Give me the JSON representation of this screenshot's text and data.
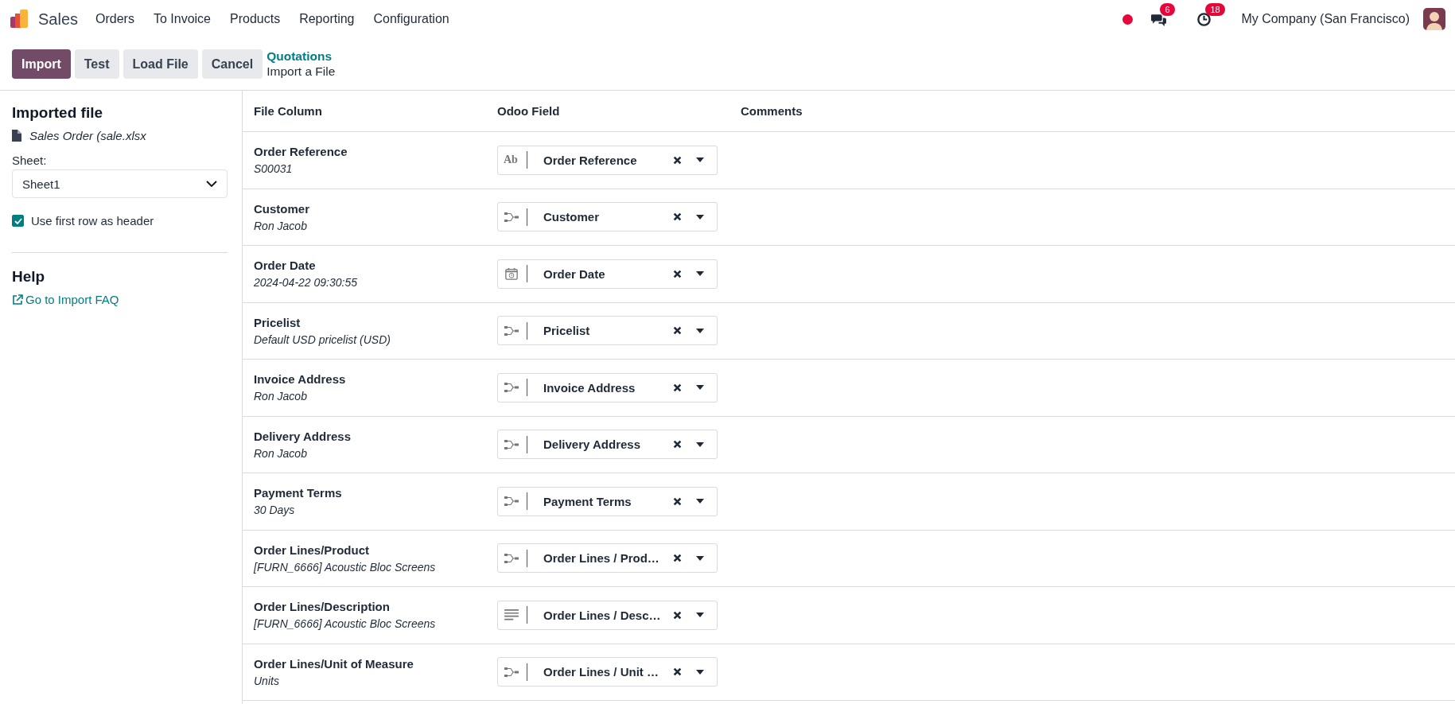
{
  "navbar": {
    "app_name": "Sales",
    "menu": [
      "Orders",
      "To Invoice",
      "Products",
      "Reporting",
      "Configuration"
    ],
    "chat_count": "6",
    "activity_count": "18",
    "company": "My Company (San Francisco)"
  },
  "toolbar": {
    "buttons": [
      {
        "label": "Import",
        "kind": "primary"
      },
      {
        "label": "Test",
        "kind": "secondary"
      },
      {
        "label": "Load File",
        "kind": "secondary"
      },
      {
        "label": "Cancel",
        "kind": "secondary"
      }
    ],
    "breadcrumb": [
      "Quotations",
      "Import a File"
    ]
  },
  "sidebar": {
    "title": "Imported file",
    "file_name": "Sales Order (sale.xlsx",
    "sheet_label": "Sheet:",
    "sheet_value": "Sheet1",
    "header_option": {
      "label": "Use first row as header",
      "checked": true
    },
    "help_title": "Help",
    "help_link": "Go to Import FAQ"
  },
  "table": {
    "columns": [
      "File Column",
      "Odoo Field",
      "Comments"
    ],
    "rows": [
      {
        "column": "Order Reference",
        "sample": "S00031",
        "field": "Order Reference",
        "kind": "char",
        "icon_text": "Ab"
      },
      {
        "column": "Customer",
        "sample": "Ron Jacob",
        "field": "Customer",
        "kind": "relation"
      },
      {
        "column": "Order Date",
        "sample": "2024-04-22 09:30:55",
        "field": "Order Date",
        "kind": "datetime"
      },
      {
        "column": "Pricelist",
        "sample": "Default USD pricelist (USD)",
        "field": "Pricelist",
        "kind": "relation"
      },
      {
        "column": "Invoice Address",
        "sample": "Ron Jacob",
        "field": "Invoice Address",
        "kind": "relation"
      },
      {
        "column": "Delivery Address",
        "sample": "Ron Jacob",
        "field": "Delivery Address",
        "kind": "relation"
      },
      {
        "column": "Payment Terms",
        "sample": "30 Days",
        "field": "Payment Terms",
        "kind": "relation"
      },
      {
        "column": "Order Lines/Product",
        "sample": "[FURN_6666] Acoustic Bloc Screens",
        "field": "Order Lines / Prod…",
        "kind": "relation"
      },
      {
        "column": "Order Lines/Description",
        "sample": "[FURN_6666] Acoustic Bloc Screens",
        "field": "Order Lines / Desc…",
        "kind": "text"
      },
      {
        "column": "Order Lines/Unit of Measure",
        "sample": "Units",
        "field": "Order Lines / Unit …",
        "kind": "relation"
      }
    ]
  }
}
